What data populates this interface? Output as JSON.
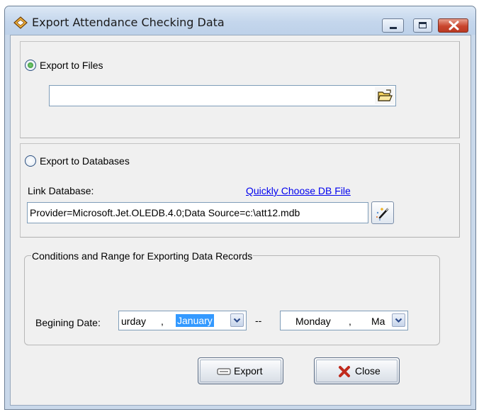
{
  "window": {
    "title": "Export Attendance Checking Data",
    "controls": {
      "minimize": "minimize",
      "maximize": "maximize",
      "close": "close"
    }
  },
  "export_files": {
    "label": "Export to Files",
    "selected": true,
    "path_value": "",
    "browse_icon": "open-folder-icon"
  },
  "export_db": {
    "label": "Export to Databases",
    "selected": false,
    "link_label": "Link Database:",
    "quick_choose_link": "Quickly Choose DB File",
    "connection_string": "Provider=Microsoft.Jet.OLEDB.4.0;Data Source=c:\\att12.mdb",
    "wizard_icon": "magic-wand-icon"
  },
  "conditions": {
    "legend": "Conditions and Range for Exporting Data Records",
    "begin_label": "Begining Date:",
    "begin_day": "urday",
    "begin_sep": ",",
    "begin_month": "January",
    "range_sep": "--",
    "end_day": "Monday",
    "end_sep": ",",
    "end_month_partial": "Ma"
  },
  "buttons": {
    "export": "Export",
    "close": "Close"
  },
  "colors": {
    "title_bar": "#c4d6ec",
    "client_bg": "#f0f0f0",
    "link": "#0000ee",
    "selection": "#3399ff",
    "close_x": "#c0291c"
  }
}
